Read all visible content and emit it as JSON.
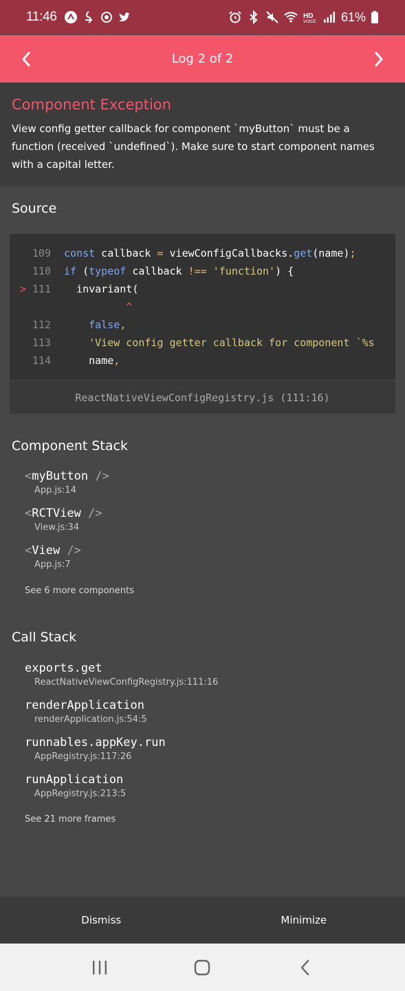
{
  "status_bar": {
    "time": "11:46",
    "battery": "61%",
    "left_icons": [
      "notification-icon",
      "app-icon",
      "sync-icon",
      "twitter-icon"
    ],
    "right_icons": [
      "alarm-icon",
      "bluetooth-icon",
      "mute-icon",
      "wifi-icon",
      "hd-voice-icon",
      "signal-icon",
      "battery-icon"
    ]
  },
  "header": {
    "title": "Log 2 of 2",
    "bg_color": "#f25668"
  },
  "exception": {
    "title": "Component Exception",
    "message": "View config getter callback for component `myButton` must be a function (received `undefined`). Make sure to start component names with a capital letter."
  },
  "source": {
    "heading": "Source",
    "lines": [
      {
        "num": "109",
        "code": "const callback = viewConfigCallbacks.get(name);"
      },
      {
        "num": "110",
        "code": "if (typeof callback !== 'function') {"
      },
      {
        "num": "111",
        "code": "  invariant(",
        "marker": ">"
      },
      {
        "num": "",
        "code": "          ^"
      },
      {
        "num": "112",
        "code": "    false,"
      },
      {
        "num": "113",
        "code": "    'View config getter callback for component `%s"
      },
      {
        "num": "114",
        "code": "    name,"
      }
    ],
    "file": "ReactNativeViewConfigRegistry.js (111:16)"
  },
  "component_stack": {
    "heading": "Component Stack",
    "items": [
      {
        "name": "myButton",
        "loc": "App.js:14"
      },
      {
        "name": "RCTView",
        "loc": "View.js:34"
      },
      {
        "name": "View",
        "loc": "App.js:7"
      }
    ],
    "see_more": "See 6 more components"
  },
  "call_stack": {
    "heading": "Call Stack",
    "items": [
      {
        "name": "exports.get",
        "loc": "ReactNativeViewConfigRegistry.js:111:16"
      },
      {
        "name": "renderApplication",
        "loc": "renderApplication.js:54:5"
      },
      {
        "name": "runnables.appKey.run",
        "loc": "AppRegistry.js:117:26"
      },
      {
        "name": "runApplication",
        "loc": "AppRegistry.js:213:5"
      }
    ],
    "see_more": "See 21 more frames"
  },
  "footer": {
    "dismiss": "Dismiss",
    "minimize": "Minimize"
  },
  "tag_open": "<",
  "tag_close": " />"
}
